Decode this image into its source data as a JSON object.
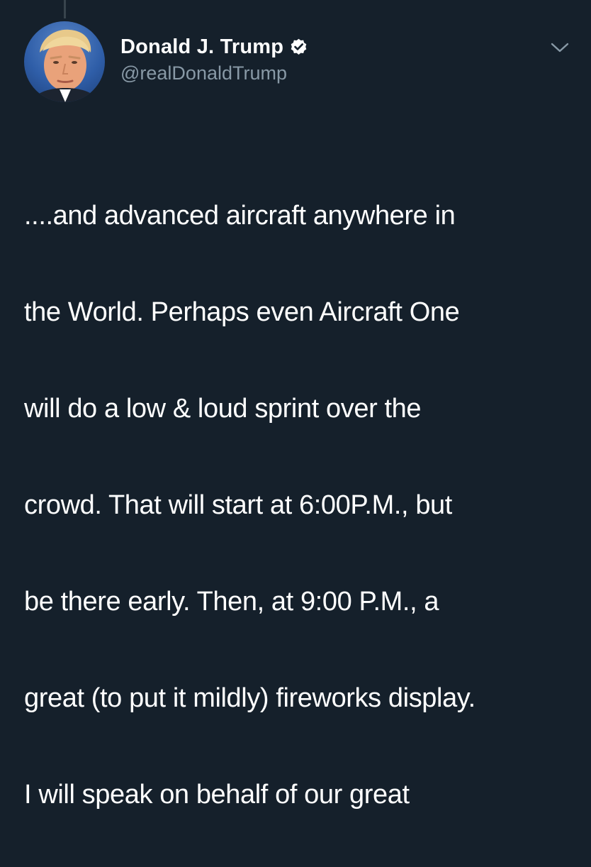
{
  "author": {
    "display_name": "Donald J. Trump",
    "handle": "@realDonaldTrump",
    "verified": true
  },
  "icons": {
    "verified": "verified-badge-icon",
    "menu": "chevron-down-icon"
  },
  "colors": {
    "background": "#15202b",
    "text_primary": "#ffffff",
    "text_secondary": "#8899a6"
  },
  "tweet": {
    "lines": [
      "....and advanced aircraft anywhere in",
      "the World. Perhaps even Aircraft One",
      "will do a low & loud sprint over the",
      "crowd. That will start at 6:00P.M., but",
      "be there early. Then, at 9:00 P.M., a",
      "great (to put it mildly) fireworks display.",
      "I will speak on behalf of our great"
    ]
  }
}
